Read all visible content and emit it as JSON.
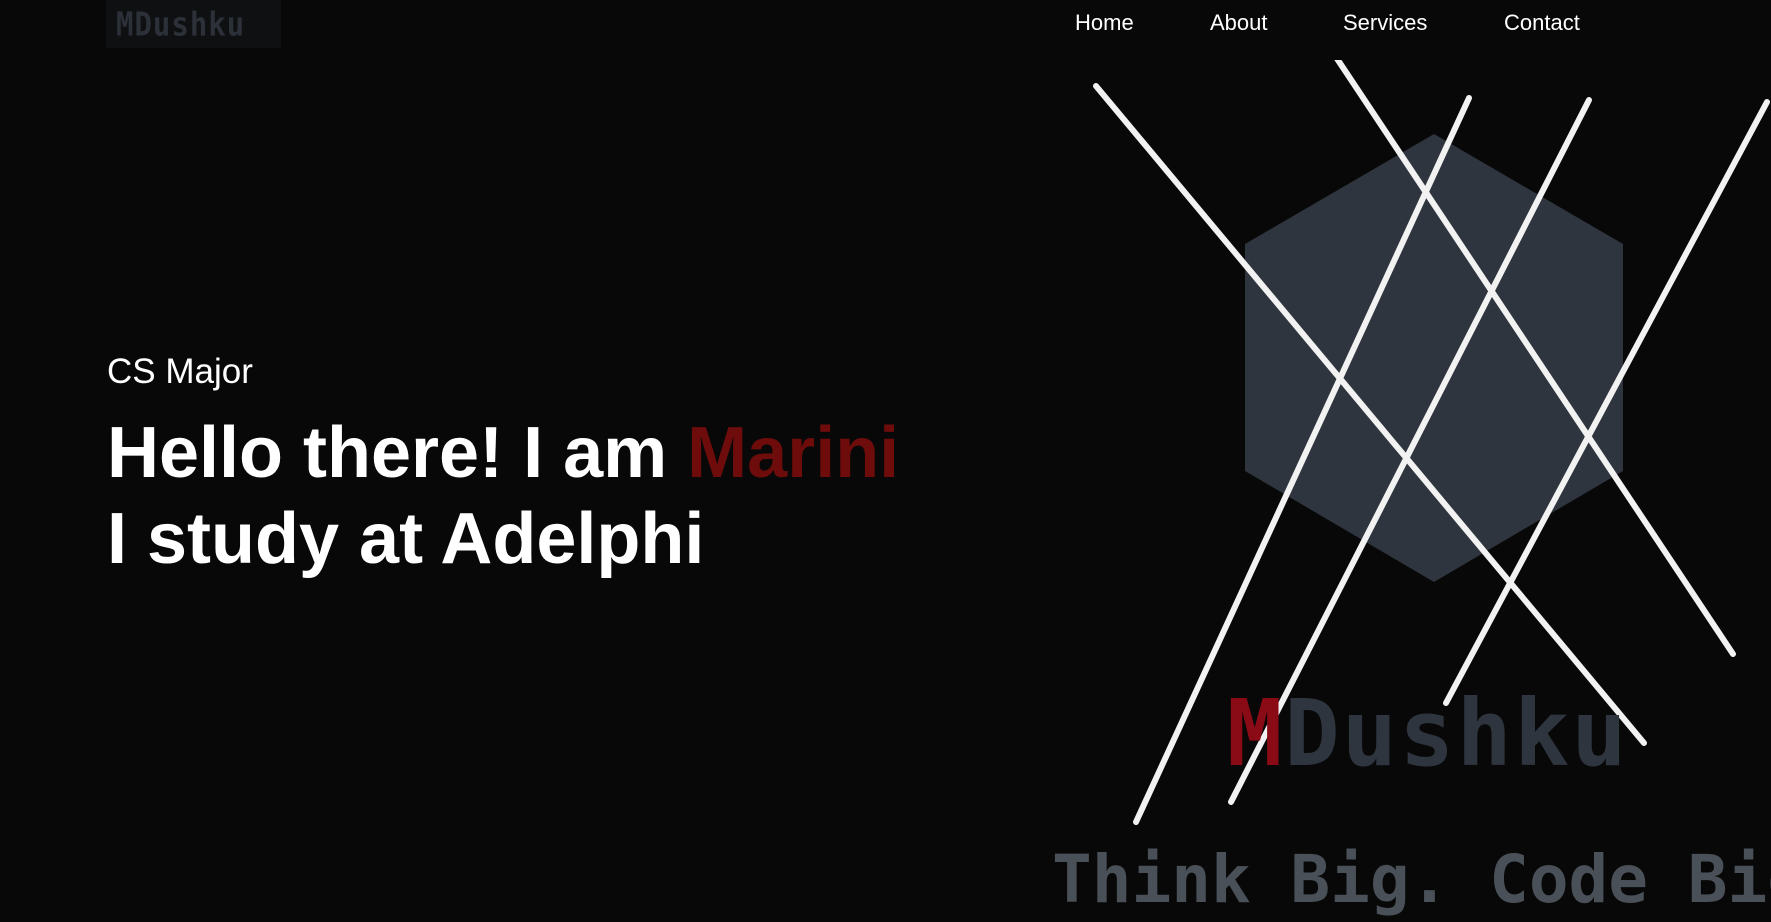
{
  "header": {
    "logo_text": "MDushku",
    "nav": [
      {
        "label": "Home"
      },
      {
        "label": "About"
      },
      {
        "label": "Services"
      },
      {
        "label": "Contact"
      }
    ]
  },
  "hero": {
    "subtitle": "CS Major",
    "headline_part1": "Hello there! I am ",
    "headline_name": "Marini",
    "headline_line2": "I study at Adelphi",
    "art": {
      "brand_initial": "M",
      "brand_rest": "Dushku",
      "tagline": "Think Big. Code Bigge"
    }
  },
  "colors": {
    "background": "#080808",
    "accent_red": "#6e0c0c",
    "logo_gray": "#2c3038",
    "hexagon": "#2f353e",
    "tagline_gray": "#4a5058"
  }
}
